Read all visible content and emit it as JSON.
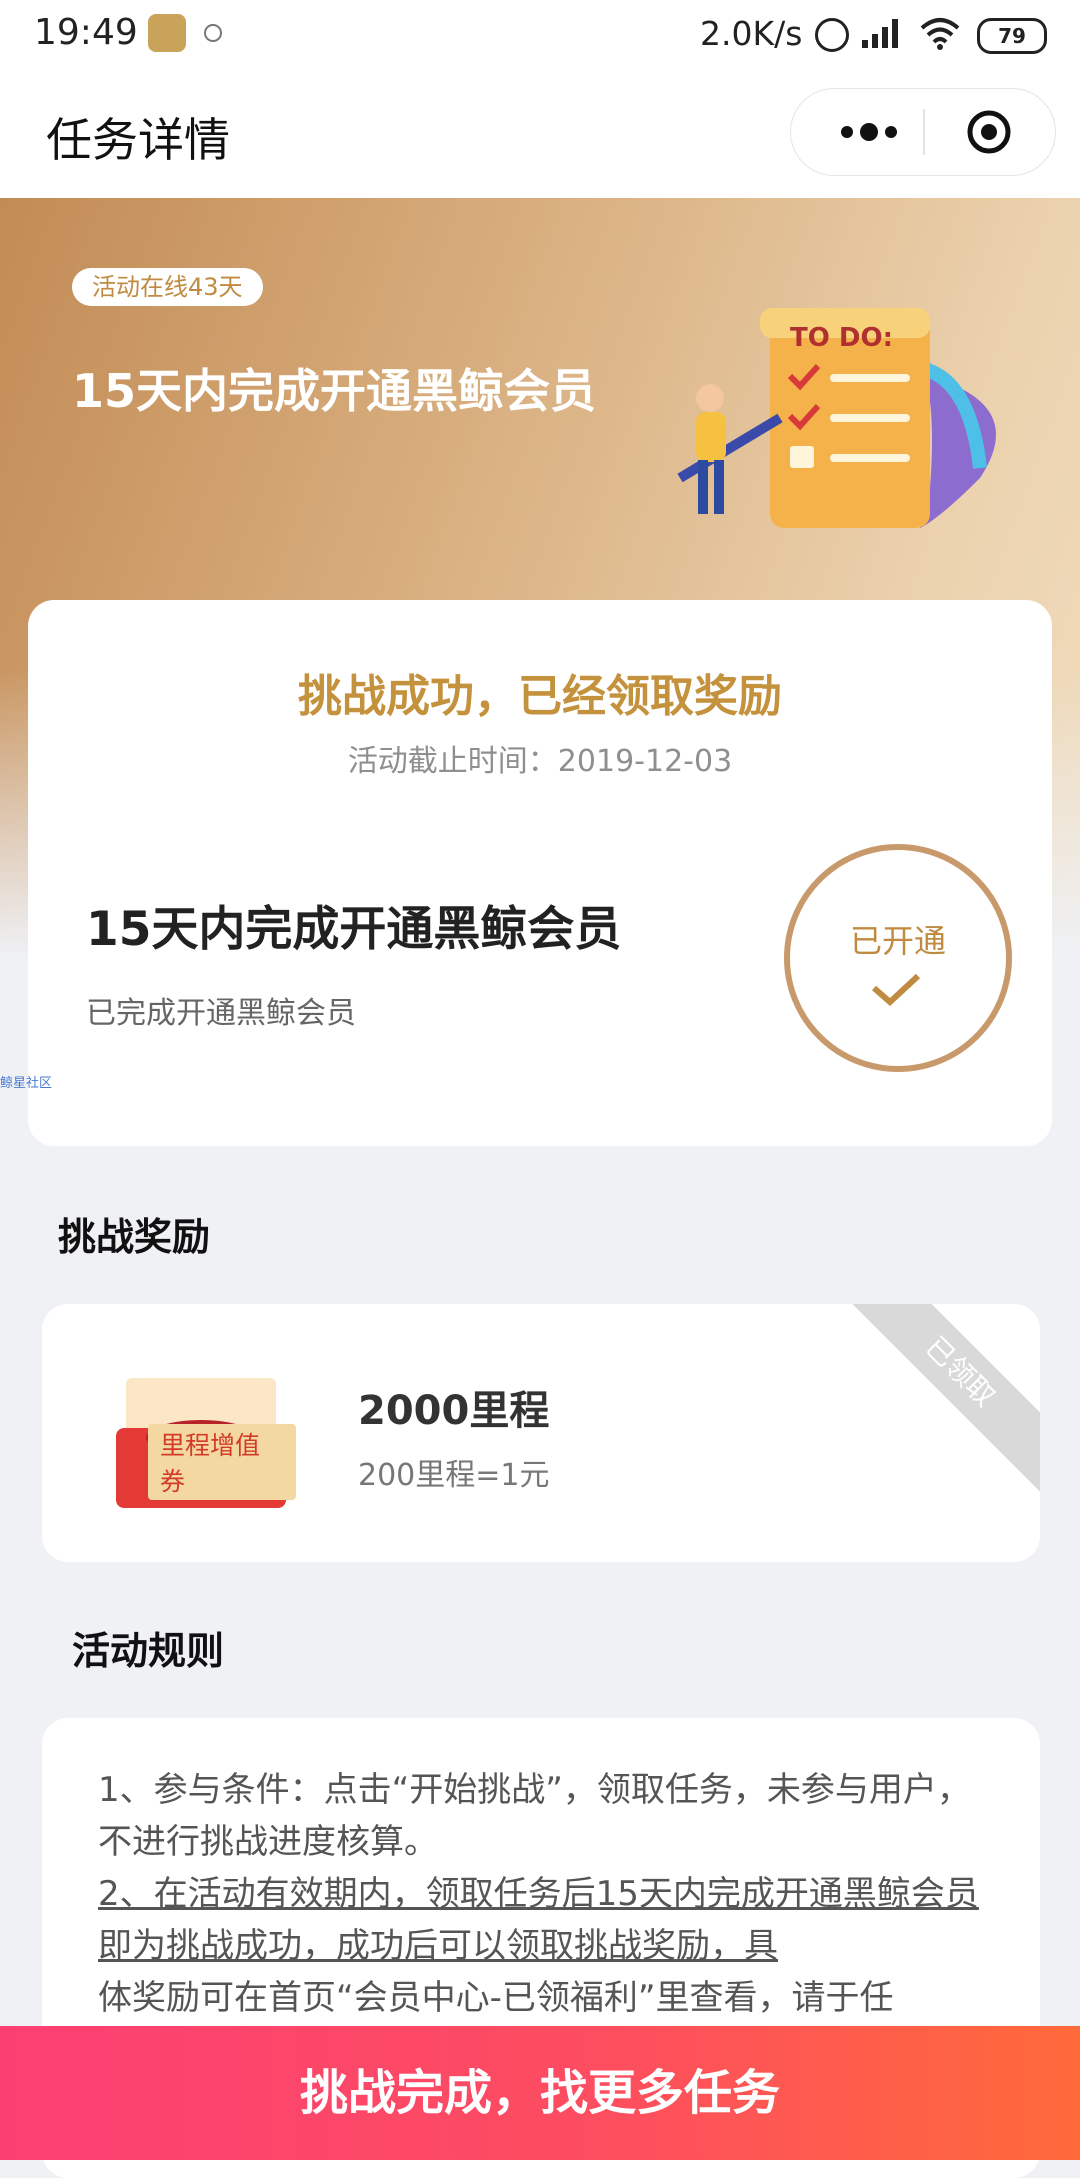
{
  "status_bar": {
    "time": "19:49",
    "speed": "2.0K/s",
    "battery": "79"
  },
  "nav": {
    "title": "任务详情",
    "more_icon": "more-icon",
    "close_icon": "target-close-icon"
  },
  "hero": {
    "badge": "活动在线43天",
    "title": "15天内完成开通黑鲸会员",
    "art_text": "TO DO:"
  },
  "status_card": {
    "title": "挑战成功，已经领取奖励",
    "deadline": "活动截止时间：2019-12-03",
    "task": "15天内完成开通黑鲸会员",
    "done_text": "已完成开通黑鲸会员",
    "circle_label": "已开通"
  },
  "watermark": "鲸星社区",
  "reward": {
    "section_title": "挑战奖励",
    "image_label": "里程增值券",
    "name": "2000里程",
    "rate": "200里程=1元",
    "ribbon": "已领取"
  },
  "rules": {
    "section_title": "活动规则",
    "line1": "1、参与条件：点击“开始挑战”，领取任务，未参与用户，不进行挑战进度核算。",
    "line2": "2、在活动有效期内，领取任务后15天内完成开通黑鲸会员即为挑战成功，成功后可以领取挑战奖励，具",
    "line3": "体奖励可在首页“会员中心-已领福利”里查看，请于任"
  },
  "cta": {
    "label": "挑战完成，找更多任务"
  },
  "colors": {
    "gold": "#c4913c",
    "cta_start": "#fc3f73",
    "cta_end": "#ff6a3a"
  }
}
